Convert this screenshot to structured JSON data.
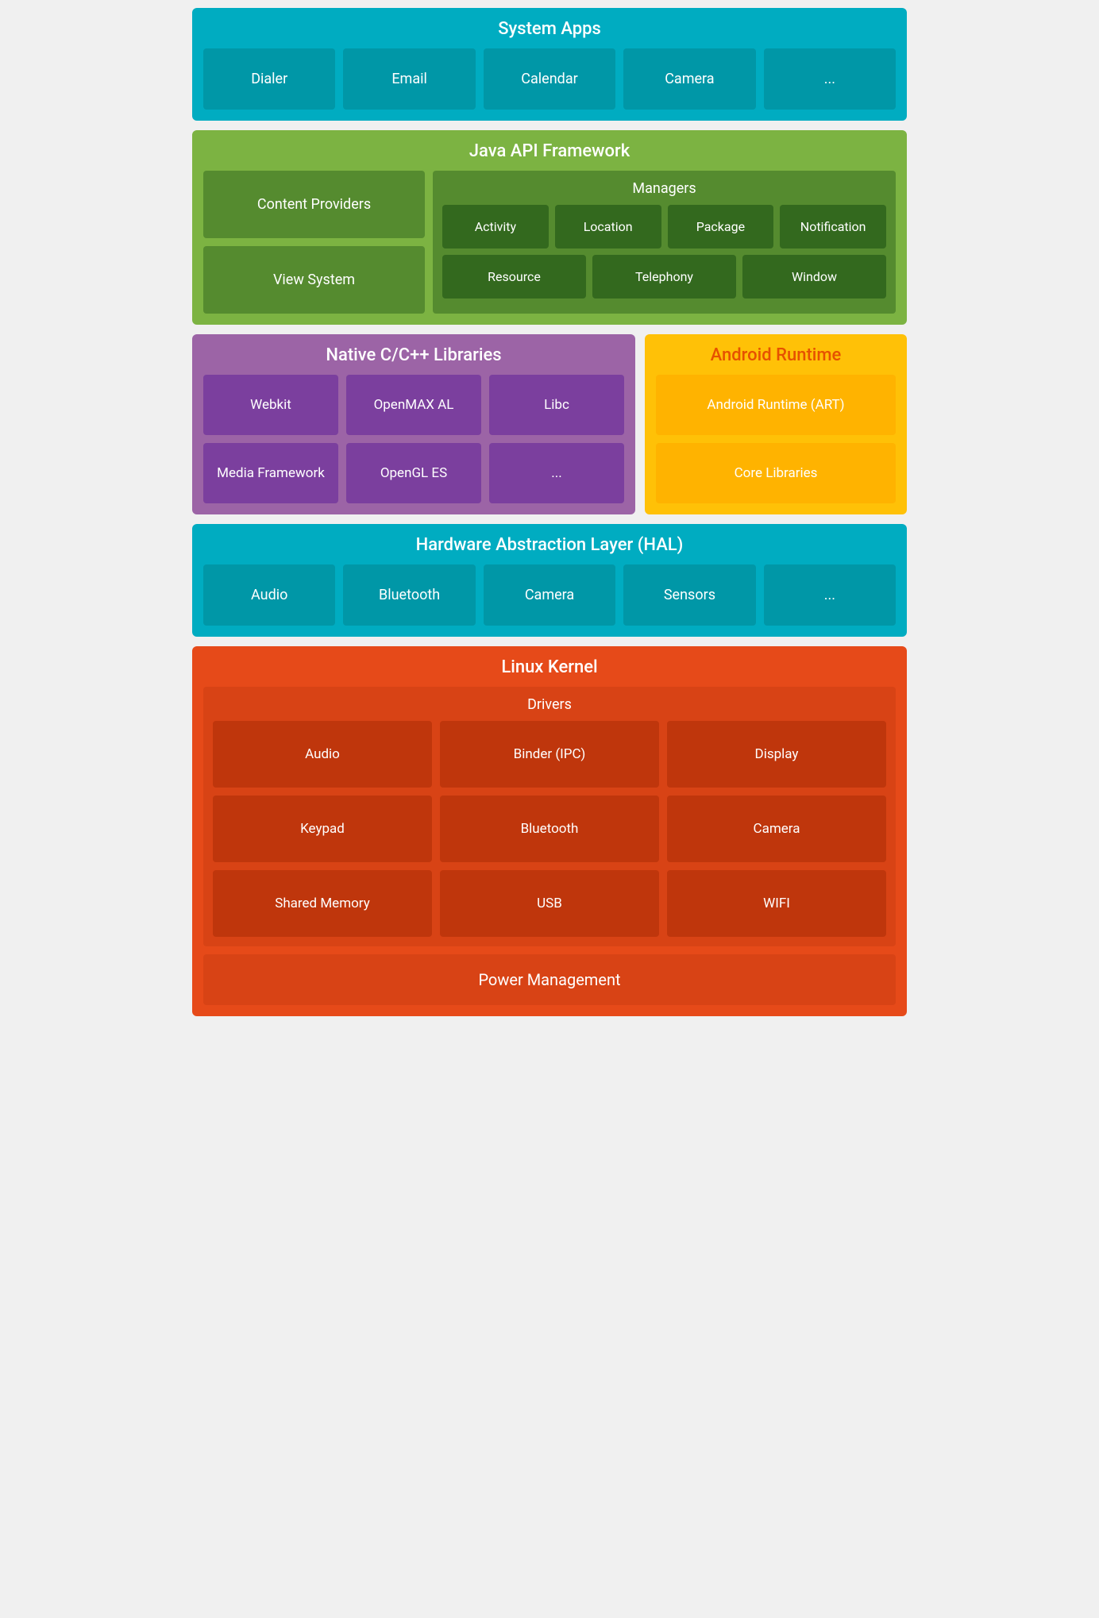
{
  "system_apps": {
    "title": "System Apps",
    "cards": [
      "Dialer",
      "Email",
      "Calendar",
      "Camera",
      "..."
    ]
  },
  "java_api": {
    "title": "Java API Framework",
    "left": {
      "items": [
        "Content Providers",
        "View System"
      ]
    },
    "managers": {
      "title": "Managers",
      "row1": [
        "Activity",
        "Location",
        "Package",
        "Notification"
      ],
      "row2": [
        "Resource",
        "Telephony",
        "Window"
      ]
    }
  },
  "native_libs": {
    "title": "Native C/C++ Libraries",
    "row1": [
      "Webkit",
      "OpenMAX AL",
      "Libc"
    ],
    "row2": [
      "Media Framework",
      "OpenGL ES",
      "..."
    ]
  },
  "android_runtime": {
    "title": "Android Runtime",
    "items": [
      "Android Runtime (ART)",
      "Core Libraries"
    ]
  },
  "hal": {
    "title": "Hardware Abstraction Layer (HAL)",
    "cards": [
      "Audio",
      "Bluetooth",
      "Camera",
      "Sensors",
      "..."
    ]
  },
  "linux_kernel": {
    "title": "Linux Kernel",
    "drivers_title": "Drivers",
    "drivers": {
      "row1": [
        "Audio",
        "Binder (IPC)",
        "Display"
      ],
      "row2": [
        "Keypad",
        "Bluetooth",
        "Camera"
      ],
      "row3": [
        "Shared Memory",
        "USB",
        "WIFI"
      ]
    },
    "power_management": "Power Management"
  }
}
